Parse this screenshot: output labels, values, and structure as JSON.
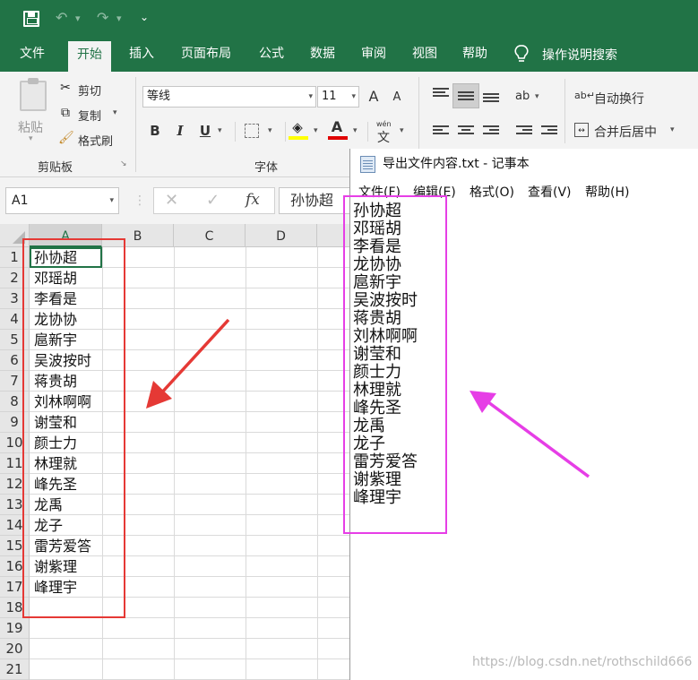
{
  "excel": {
    "quick_access": {
      "undo": "↶",
      "redo": "↷",
      "more": "⌄"
    },
    "tabs": [
      "文件",
      "开始",
      "插入",
      "页面布局",
      "公式",
      "数据",
      "审阅",
      "视图",
      "帮助"
    ],
    "active_tab": "开始",
    "tell_me": "操作说明搜索",
    "clipboard": {
      "paste": "粘贴",
      "cut": "剪切",
      "copy": "复制",
      "format_painter": "格式刷",
      "group_label": "剪贴板"
    },
    "font": {
      "name": "等线",
      "size": "11",
      "grow": "A",
      "shrink": "A",
      "bold": "B",
      "italic": "I",
      "underline": "U",
      "font_color": "A",
      "phonetic": "wén",
      "group_label": "字体"
    },
    "alignment": {
      "wrap_text": "自动换行",
      "merge_center": "合并后居中"
    },
    "name_box": "A1",
    "formula_value": "孙协超",
    "fx_label": "fx",
    "columns": [
      "A",
      "B",
      "C",
      "D"
    ],
    "selected_column": "A",
    "rows": [
      "1",
      "2",
      "3",
      "4",
      "5",
      "6",
      "7",
      "8",
      "9",
      "10",
      "11",
      "12",
      "13",
      "14",
      "15",
      "16",
      "17",
      "18",
      "19",
      "20",
      "21"
    ],
    "cells_a": [
      "孙协超",
      "邓瑶胡",
      "李看是",
      "龙协协",
      "扈新宇",
      "吴波按时",
      "蒋贵胡",
      "刘林啊啊",
      "谢莹和",
      "颜士力",
      "林理就",
      "峰先圣",
      "龙禹",
      "龙子",
      "雷芳爱答",
      "谢紫理",
      "峰理宇"
    ]
  },
  "notepad": {
    "title": "导出文件内容.txt - 记事本",
    "menu": [
      "文件(F)",
      "编辑(E)",
      "格式(O)",
      "查看(V)",
      "帮助(H)"
    ],
    "lines": [
      "孙协超",
      "邓瑶胡",
      "李看是",
      "龙协协",
      "扈新宇",
      "吴波按时",
      "蒋贵胡",
      "刘林啊啊",
      "谢莹和",
      "颜士力",
      "林理就",
      "峰先圣",
      "龙禹",
      "龙子",
      "雷芳爱答",
      "谢紫理",
      "峰理宇"
    ]
  },
  "watermark": "https://blog.csdn.net/rothschild666",
  "colors": {
    "excel_green": "#217346",
    "red_annotation": "#e53935",
    "magenta_annotation": "#e63ee6"
  }
}
